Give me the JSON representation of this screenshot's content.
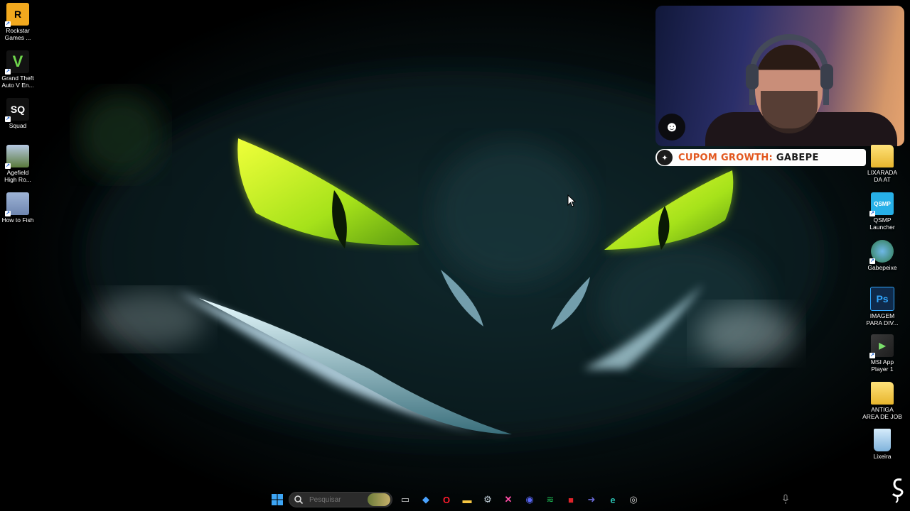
{
  "desktop": {
    "left_icons": [
      {
        "label": "Rockstar\nGames ...",
        "icon": "rockstar-icon",
        "color": "#f2a91e",
        "glyph": "R"
      },
      {
        "label": "Grand Theft\nAuto V En...",
        "icon": "gta-v-icon",
        "color": "#3a7a2e",
        "glyph": "V"
      },
      {
        "label": "Squad",
        "icon": "squad-icon",
        "color": "#1b1b1b",
        "glyph": "SQ"
      },
      {
        "label": "Agefield\nHigh Ro...",
        "icon": "agefield-icon",
        "color": "#6c8a4a",
        "glyph": ""
      },
      {
        "label": "How to Fish",
        "icon": "how-to-fish-icon",
        "color": "#8aa0c8",
        "glyph": ""
      }
    ],
    "right_icons": [
      {
        "label": "LIXARADA\nDA AT",
        "icon": "folder-icon",
        "color": "#f5c542",
        "glyph": ""
      },
      {
        "label": "QSMP\nLauncher",
        "icon": "qsmp-icon",
        "color": "#27b0e8",
        "glyph": "QSMP"
      },
      {
        "label": "Gabepeixe",
        "icon": "gabepeixe-icon",
        "color": "#2f9a57",
        "glyph": ""
      },
      {
        "label": "IMAGEM\nPARA DIV...",
        "icon": "photoshop-psd-icon",
        "color": "#0f2a4a",
        "glyph": "Ps"
      },
      {
        "label": "MSI App\nPlayer 1",
        "icon": "msi-app-player-icon",
        "color": "#2d2d2d",
        "glyph": ""
      },
      {
        "label": "ANTIGA\nAREA DE JOB",
        "icon": "folder-icon",
        "color": "#f5c542",
        "glyph": ""
      },
      {
        "label": "Lixeira",
        "icon": "recycle-bin-icon",
        "color": "#8ab8e0",
        "glyph": ""
      }
    ]
  },
  "stream_overlay": {
    "coupon_prefix": "CUPOM GROWTH:",
    "coupon_code": "GABEPE",
    "accent_color": "#e2571e"
  },
  "taskbar": {
    "search_placeholder": "Pesquisar",
    "pinned": [
      {
        "name": "task-view-icon",
        "color": "#d8d8d8",
        "glyph": "▭"
      },
      {
        "name": "copilot-icon",
        "color": "#4aa3ff",
        "glyph": "◆"
      },
      {
        "name": "opera-icon",
        "color": "#ff1b2d",
        "glyph": "O"
      },
      {
        "name": "file-explorer-icon",
        "color": "#f5c542",
        "glyph": "▬"
      },
      {
        "name": "steam-icon",
        "color": "#c7d5e0",
        "glyph": "⚙"
      },
      {
        "name": "capcut-icon",
        "color": "#ff4da6",
        "glyph": "✕"
      },
      {
        "name": "discord-icon",
        "color": "#5865f2",
        "glyph": "◉"
      },
      {
        "name": "spotify-icon",
        "color": "#1db954",
        "glyph": "≋"
      },
      {
        "name": "app-red-icon",
        "color": "#e0242a",
        "glyph": "■"
      },
      {
        "name": "arrow-app-icon",
        "color": "#6b6bd6",
        "glyph": "➜"
      },
      {
        "name": "edge-icon",
        "color": "#2bbfb0",
        "glyph": "e"
      },
      {
        "name": "obs-icon",
        "color": "#cfcfcf",
        "glyph": "◎"
      }
    ]
  }
}
